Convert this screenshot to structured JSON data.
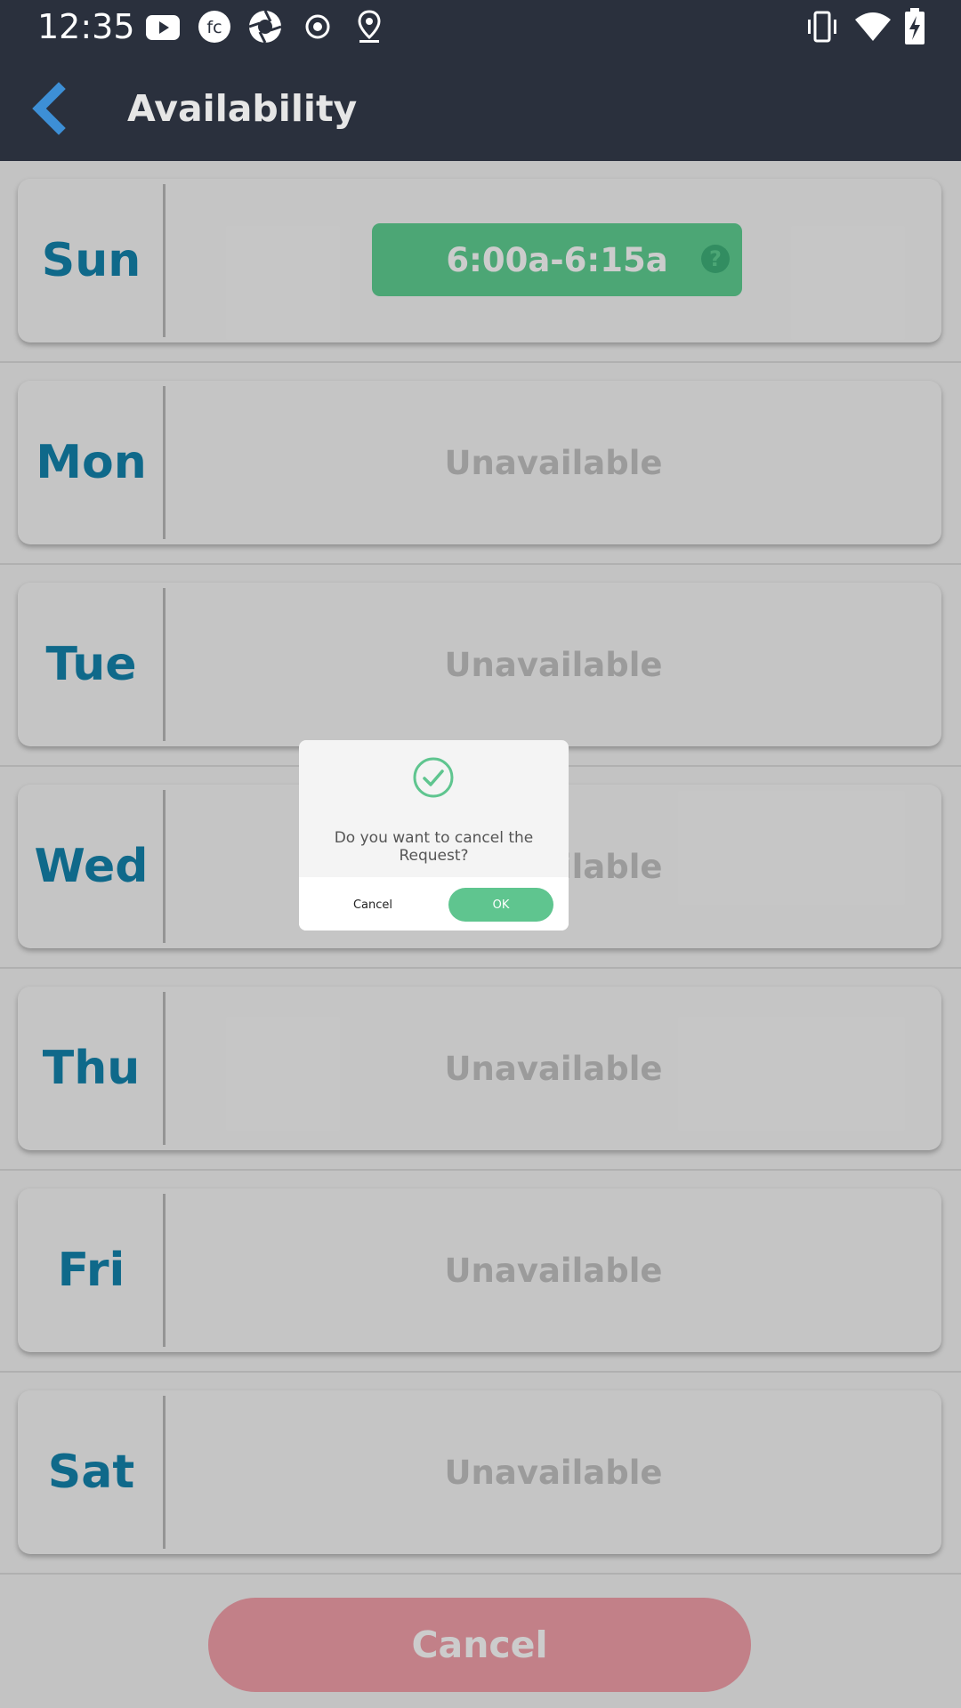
{
  "status_bar": {
    "time": "12:35",
    "left_icons": [
      "youtube-icon",
      "fc-app-icon",
      "camera-aperture-icon",
      "radio-record-icon",
      "location-pin-icon"
    ],
    "right_icons": [
      "vibrate-icon",
      "wifi-icon",
      "battery-charging-icon"
    ]
  },
  "app_bar": {
    "title": "Availability",
    "back_icon": "chevron-left-icon",
    "back_color": "#3d8fd6",
    "background": "#2a303d"
  },
  "days": [
    {
      "day": "Sun",
      "slot": "6:00a-6:15a",
      "available": true
    },
    {
      "day": "Mon",
      "slot": "Unavailable",
      "available": false
    },
    {
      "day": "Tue",
      "slot": "Unavailable",
      "available": false
    },
    {
      "day": "Wed",
      "slot": "Unavailable",
      "available": false
    },
    {
      "day": "Thu",
      "slot": "Unavailable",
      "available": false
    },
    {
      "day": "Fri",
      "slot": "Unavailable",
      "available": false
    },
    {
      "day": "Sat",
      "slot": "Unavailable",
      "available": false
    }
  ],
  "colors": {
    "day_label": "#1384ad",
    "slot_available": "#5fd093",
    "cancel_button": "#f3a0ab"
  },
  "bottom": {
    "cancel_label": "Cancel"
  },
  "dialog": {
    "icon": "check-circle-icon",
    "message": "Do you want to cancel the Request?",
    "cancel_label": "Cancel",
    "ok_label": "OK"
  }
}
